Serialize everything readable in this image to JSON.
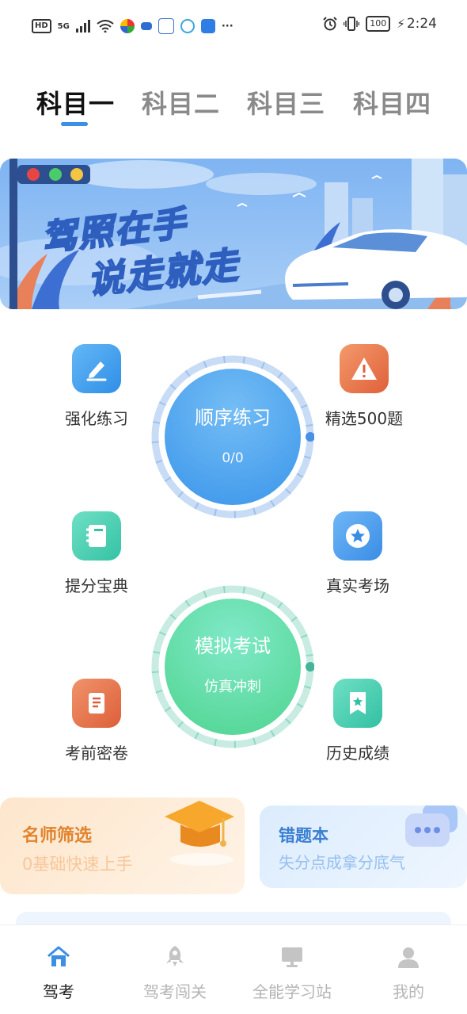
{
  "status_bar": {
    "network": "5G",
    "battery": "100",
    "time": "2:24",
    "more": "···"
  },
  "tabs": [
    {
      "label": "科目一",
      "active": true
    },
    {
      "label": "科目二",
      "active": false
    },
    {
      "label": "科目三",
      "active": false
    },
    {
      "label": "科目四",
      "active": false
    }
  ],
  "banner": {
    "line1_part1": "驾照",
    "line1_part2": "在手",
    "line2": "说走就走"
  },
  "features": {
    "qianghua": "强化练习",
    "jingxuan": "精选500题",
    "tifen": "提分宝典",
    "zhenshi": "真实考场",
    "kaoqian": "考前密卷",
    "lishi": "历史成绩"
  },
  "circles": {
    "sequential": {
      "title": "顺序练习",
      "progress": "0/0"
    },
    "mock": {
      "title": "模拟考试",
      "subtitle": "仿真冲刺"
    }
  },
  "cards": {
    "teacher": {
      "title": "名师筛选",
      "subtitle": "0基础快速上手"
    },
    "mistakes": {
      "title": "错题本",
      "subtitle": "失分点成拿分底气"
    }
  },
  "bottom_nav": [
    {
      "label": "驾考",
      "active": true,
      "icon": "home-icon"
    },
    {
      "label": "驾考闯关",
      "active": false,
      "icon": "rocket-icon"
    },
    {
      "label": "全能学习站",
      "active": false,
      "icon": "monitor-icon"
    },
    {
      "label": "我的",
      "active": false,
      "icon": "user-icon"
    }
  ],
  "colors": {
    "accent": "#3b8fe5",
    "blue_circle": "#5aaaf0",
    "green_circle": "#5fd6a6",
    "orange": "#e8753f",
    "teal": "#3fc9ad"
  }
}
